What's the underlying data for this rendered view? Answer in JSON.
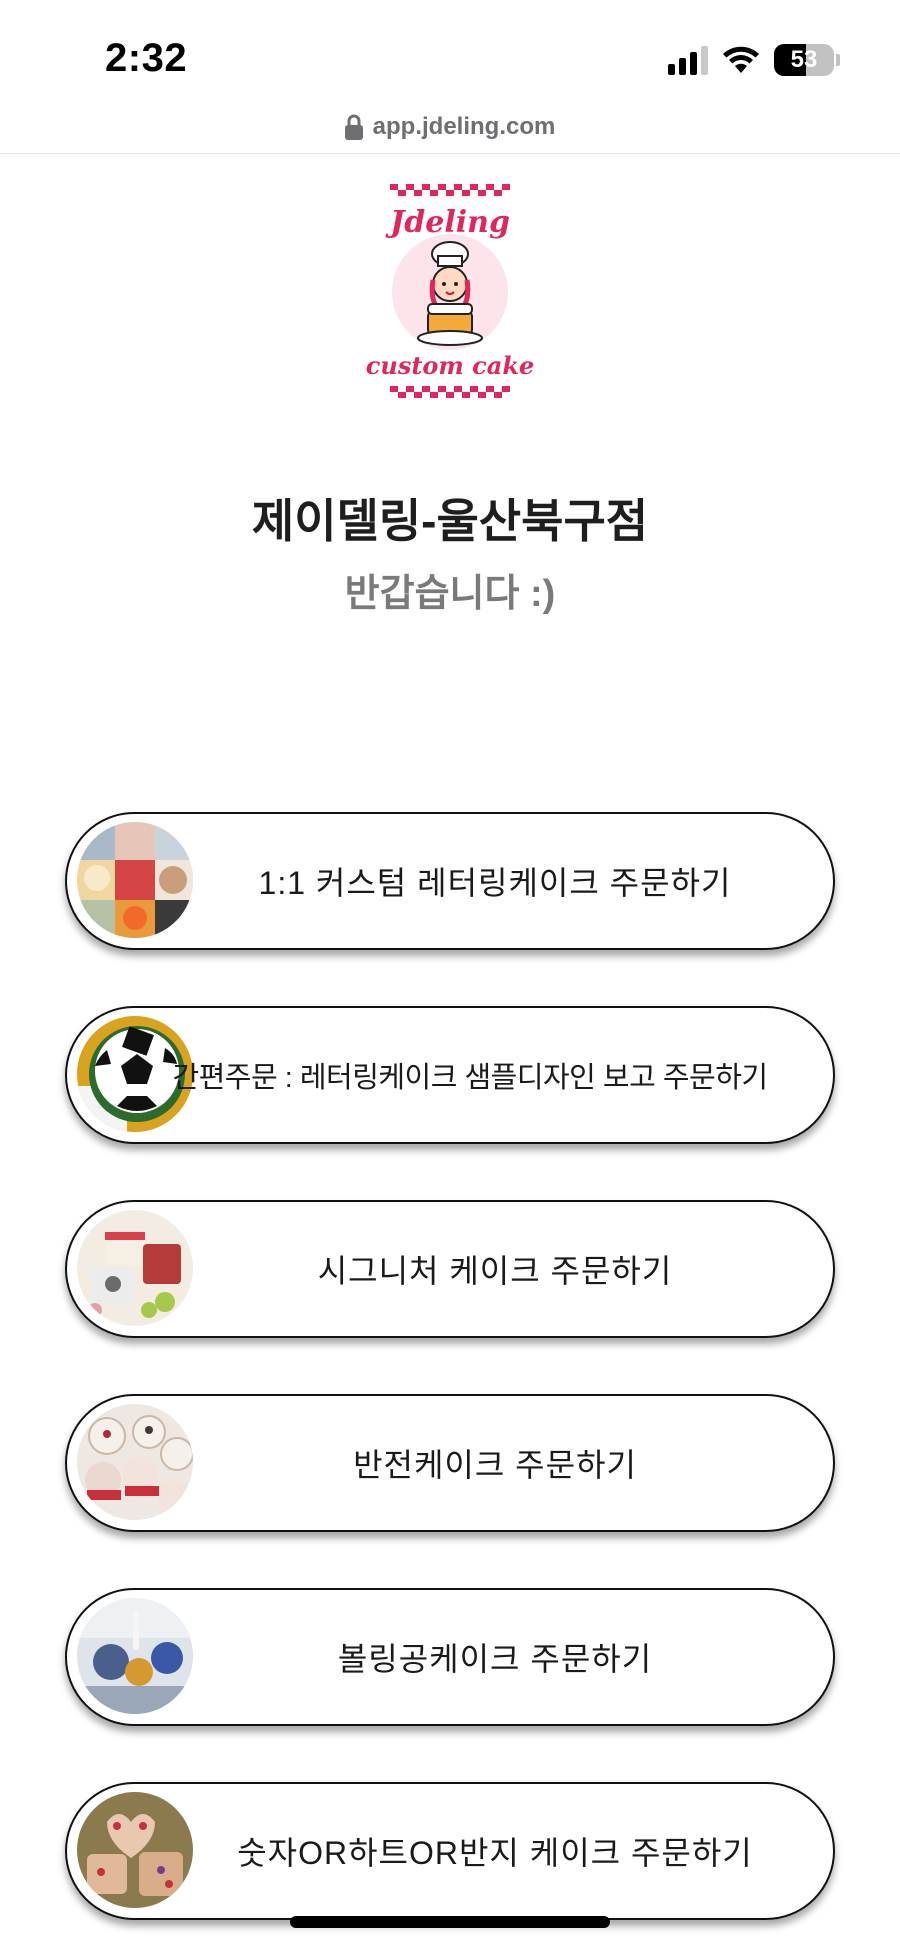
{
  "status_bar": {
    "time": "2:32",
    "battery_percent": "53",
    "battery_level": 0.53,
    "signal_bars": 3,
    "icons": [
      "cellular-signal-icon",
      "wifi-icon",
      "battery-icon"
    ]
  },
  "browser": {
    "url": "app.jdeling.com",
    "lock_icon": "lock-icon"
  },
  "logo": {
    "brand_top": "Jdeling",
    "brand_bottom": "custom cake",
    "colors": {
      "brand_pink": "#e0265a",
      "light_pink": "#fde4ea",
      "cake_orange": "#f4a93a"
    }
  },
  "store": {
    "title": "제이델링-울산북구점",
    "greeting": "반갑습니다 :)"
  },
  "menu": [
    {
      "label": "1:1 커스텀 레터링케이크 주문하기",
      "thumb": "custom-lettering-cake-photo"
    },
    {
      "label": "간편주문 : 레터링케이크 샘플디자인 보고 주문하기",
      "thumb": "soccer-ball-cake-photo"
    },
    {
      "label": "시그니처 케이크 주문하기",
      "thumb": "signature-cake-photo"
    },
    {
      "label": "반전케이크 주문하기",
      "thumb": "reversal-cake-photo"
    },
    {
      "label": "볼링공케이크 주문하기",
      "thumb": "bowling-ball-cake-photo"
    },
    {
      "label": "숫자OR하트OR반지 케이크 주문하기",
      "thumb": "number-heart-ring-cake-photo"
    }
  ]
}
